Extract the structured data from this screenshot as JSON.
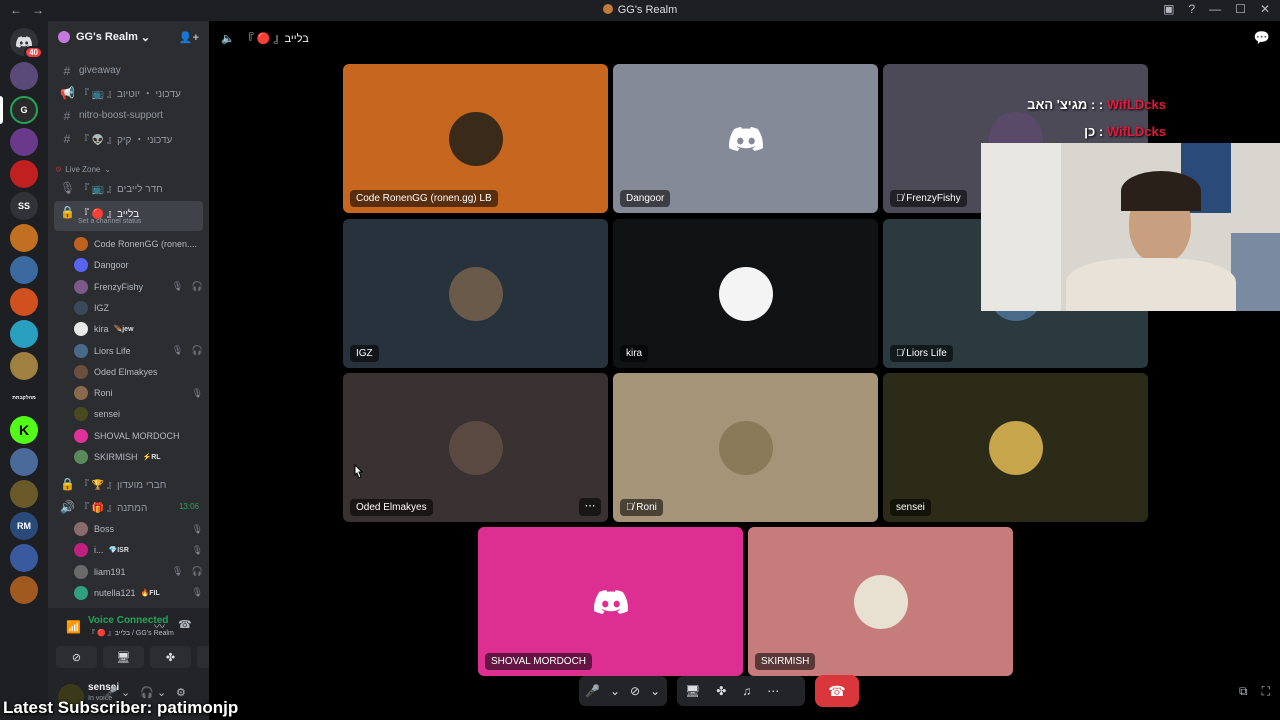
{
  "window": {
    "title": "GG's Realm",
    "back_icon": "←",
    "forward_icon": "→"
  },
  "guilds": {
    "home_badge": "40",
    "text_icons": [
      "SS",
      "מהלקבתת",
      "RM"
    ]
  },
  "server": {
    "name": "GG's Realm"
  },
  "channels": [
    {
      "name": "giveaway",
      "type": "text"
    },
    {
      "name": "『 📺 』עדכוני ・ יוטיוב",
      "type": "announcement"
    },
    {
      "name": "nitro-boost-support",
      "type": "text"
    },
    {
      "name": "『 👽 』עדכוני ・ קיק",
      "type": "text"
    }
  ],
  "live_zone": {
    "category": "Live Zone",
    "channel_waiting": "『 📺 』חדר לייבים",
    "active_channel": "『 🔴 』בלייב",
    "active_channel_sub": "Set a channel status",
    "members": [
      {
        "name": "Code RonenGG (ronen....",
        "color": "#c0621f",
        "tag": "",
        "flags": ""
      },
      {
        "name": "Dangoor",
        "color": "#5865f2",
        "tag": "",
        "flags": ""
      },
      {
        "name": "FrenzyFishy",
        "color": "#7d5a8a",
        "tag": "",
        "flags": "🎙 🎧"
      },
      {
        "name": "IGZ",
        "color": "#3a4a5a",
        "tag": "",
        "flags": ""
      },
      {
        "name": "kira",
        "color": "#e8e8e8",
        "tag": "🪶jew",
        "flags": ""
      },
      {
        "name": "Liors Life",
        "color": "#4a6a8a",
        "tag": "",
        "flags": "🎙 🎧"
      },
      {
        "name": "Oded Elmakyes",
        "color": "#6a5040",
        "tag": "",
        "flags": ""
      },
      {
        "name": "Roni",
        "color": "#8a6a4a",
        "tag": "",
        "flags": "🎙"
      },
      {
        "name": "sensei",
        "color": "#4a4a20",
        "tag": "",
        "flags": ""
      },
      {
        "name": "SHOVAL MORDOCH",
        "color": "#e0309a",
        "tag": "",
        "flags": ""
      },
      {
        "name": "SKIRMISH",
        "color": "#5a8a5a",
        "tag": "⚡RL",
        "flags": ""
      }
    ],
    "locked_channel": "『 🏆 』חברי מועדון",
    "gift_channel": "『 🎁 』המתנה",
    "gift_time": "13:06",
    "gift_members": [
      {
        "name": "Boss",
        "color": "#8a6a6a",
        "tag": "",
        "flags": "🎙"
      },
      {
        "name": "i...",
        "color": "#c02080",
        "tag": "💎ISR",
        "flags": "🎙"
      },
      {
        "name": "liam191",
        "color": "#6a6a6a",
        "tag": "",
        "flags": "🎙 🎧"
      },
      {
        "name": "nutella121",
        "color": "#30a080",
        "tag": "🔥FIL",
        "flags": "🎙"
      }
    ]
  },
  "voice_panel": {
    "status": "Voice Connected",
    "location": "『 🔴 』בלייב / GG's Realm"
  },
  "user_panel": {
    "name": "sensei",
    "status": "In voice"
  },
  "stream_overlay": {
    "latest_subscriber": "Latest Subscriber: patimonjp",
    "chat_lines": [
      {
        "nick": "WifLDcks",
        "message": "מגיצ' האב : :"
      },
      {
        "nick": "WifLDcks",
        "message": "כן :"
      }
    ]
  },
  "stage": {
    "channel_label": "『 🔴 』בלייב",
    "tiles": [
      {
        "label": "Code RonenGG (ronen.gg) LB",
        "bg": "#c6661f",
        "avatar": "#3a2a1a",
        "muted": false
      },
      {
        "label": "Dangoor",
        "bg": "#858a98",
        "avatar": "discord",
        "muted": false
      },
      {
        "label": "FrenzyFishy",
        "bg": "#4d4a58",
        "avatar": "#5a4a6a",
        "muted": true
      },
      {
        "label": "IGZ",
        "bg": "#28323d",
        "avatar": "#6a5a4a",
        "muted": false
      },
      {
        "label": "kira",
        "bg": "#111214",
        "avatar": "#f4f4f4",
        "muted": false
      },
      {
        "label": "Liors Life",
        "bg": "#2a3a3e",
        "avatar": "#4a6a8a",
        "muted": true
      },
      {
        "label": "Oded Elmakyes",
        "bg": "#3a3232",
        "avatar": "#5a4a40",
        "muted": false
      },
      {
        "label": "Roni",
        "bg": "#a59477",
        "avatar": "#8a7a5a",
        "muted": true
      },
      {
        "label": "sensei",
        "bg": "#2c2b18",
        "avatar": "#c7a54a",
        "muted": false
      },
      {
        "label": "SHOVAL MORDOCH",
        "bg": "#dd2f91",
        "avatar": "discord",
        "muted": false
      },
      {
        "label": "SKIRMISH",
        "bg": "#c77c7c",
        "avatar": "#e8e0d0",
        "muted": false
      }
    ]
  },
  "colors": {
    "accent_green": "#23a55a",
    "danger_red": "#da373c",
    "discord_blurple": "#5865f2"
  }
}
